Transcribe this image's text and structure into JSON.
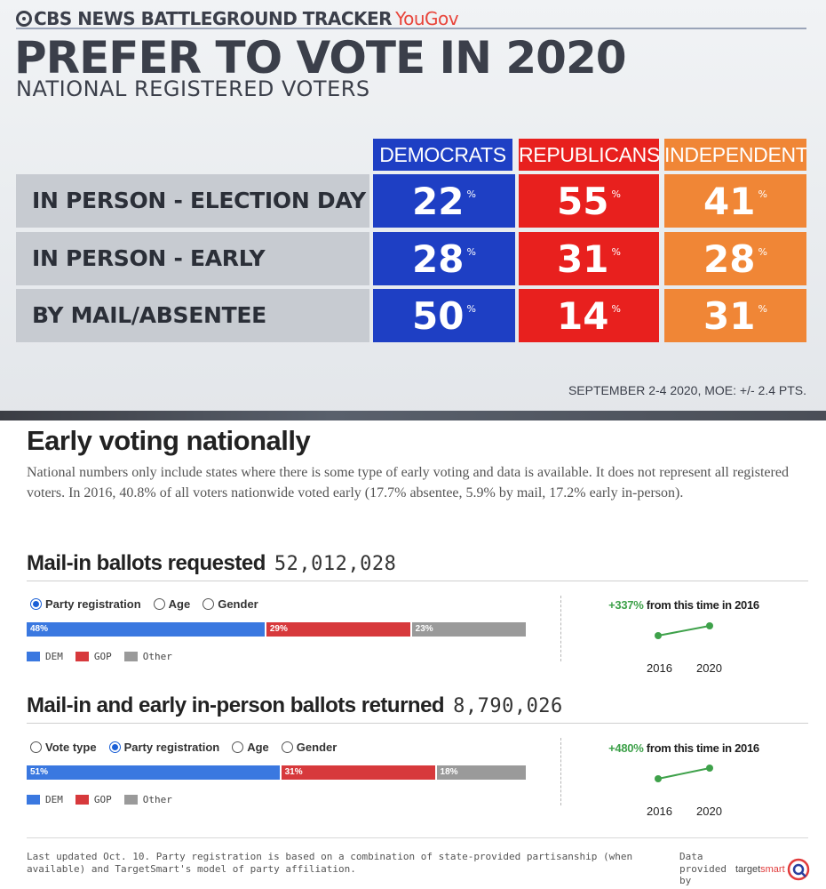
{
  "cbs": {
    "brand": "CBS NEWS BATTLEGROUND TRACKER",
    "partner": "YouGov",
    "title": "PREFER TO VOTE IN 2020",
    "subtitle": "NATIONAL REGISTERED VOTERS",
    "columns": [
      "DEMOCRATS",
      "REPUBLICANS",
      "INDEPENDENTS"
    ],
    "rows": [
      {
        "label": "IN PERSON - ELECTION DAY",
        "values": [
          "22",
          "55",
          "41"
        ]
      },
      {
        "label": "IN PERSON - EARLY",
        "values": [
          "28",
          "31",
          "28"
        ]
      },
      {
        "label": "BY MAIL/ABSENTEE",
        "values": [
          "50",
          "14",
          "31"
        ]
      }
    ],
    "pct_symbol": "%",
    "footer": "SEPTEMBER 2-4 2020, MOE: +/- 2.4 PTS.",
    "colors": {
      "dem": "#1e3fc4",
      "gop": "#e8201e",
      "ind": "#f08636"
    }
  },
  "early": {
    "title": "Early voting nationally",
    "intro": "National numbers only include states where there is some type of early voting and data is available. It does not represent all registered voters. In 2016, 40.8% of all voters nationwide voted early (17.7% absentee, 5.9% by mail, 17.2% early in-person)."
  },
  "requested": {
    "title": "Mail-in ballots requested",
    "count": "52,012,028",
    "filters": [
      {
        "label": "Party registration",
        "selected": true
      },
      {
        "label": "Age",
        "selected": false
      },
      {
        "label": "Gender",
        "selected": false
      }
    ],
    "bar": [
      {
        "label": "48%",
        "value": 48,
        "color": "#3a78e0"
      },
      {
        "label": "29%",
        "value": 29,
        "color": "#d7393c"
      },
      {
        "label": "23%",
        "value": 23,
        "color": "#9a9a9a"
      }
    ],
    "change_pct": "+337%",
    "change_text": " from this time in 2016",
    "spark_years": [
      "2016",
      "2020"
    ]
  },
  "returned": {
    "title": "Mail-in and early in-person ballots returned",
    "count": "8,790,026",
    "filters": [
      {
        "label": "Vote type",
        "selected": false
      },
      {
        "label": "Party registration",
        "selected": true
      },
      {
        "label": "Age",
        "selected": false
      },
      {
        "label": "Gender",
        "selected": false
      }
    ],
    "bar": [
      {
        "label": "51%",
        "value": 51,
        "color": "#3a78e0"
      },
      {
        "label": "31%",
        "value": 31,
        "color": "#d7393c"
      },
      {
        "label": "18%",
        "value": 18,
        "color": "#9a9a9a"
      }
    ],
    "change_pct": "+480%",
    "change_text": " from this time in 2016",
    "spark_years": [
      "2016",
      "2020"
    ]
  },
  "legend": [
    "DEM",
    "GOP",
    "Other"
  ],
  "footer": {
    "note": "Last updated Oct. 10. Party registration is based on a combination of state-provided partisanship (when available) and TargetSmart's model of party affiliation.",
    "provided_by": "Data provided by",
    "logo_a": "target",
    "logo_b": "smart"
  }
}
